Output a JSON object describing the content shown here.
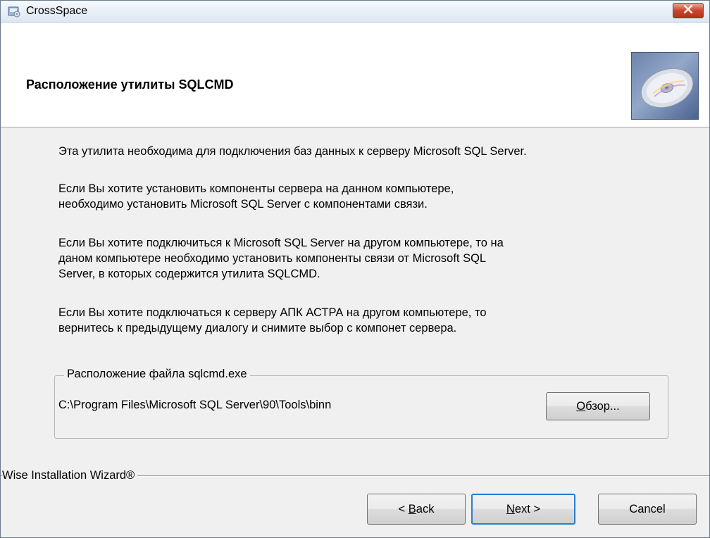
{
  "window": {
    "title": "CrossSpace"
  },
  "header": {
    "title": "Расположение утилиты SQLCMD"
  },
  "body": {
    "paragraphs": [
      [
        "Эта утилита необходима для подключения баз данных к серверу Microsoft SQL Server."
      ],
      [
        "Если Вы хотите установить компоненты сервера на данном компьютере,",
        "необходимо установить Microsoft SQL Server с компонентами связи."
      ],
      [
        "Если Вы хотите подключиться к Microsoft SQL Server на другом компьютере, то на",
        "даном компьютере необходимо установить компоненты связи от Microsoft SQL",
        "Server, в которых содержится утилита SQLCMD."
      ],
      [
        "Если Вы хотите подключаться к серверу АПК АСТРА на другом  компьютере, то",
        "вернитесь к предыдущему диалогу и снимите выбор с компонет сервера."
      ]
    ]
  },
  "file_location": {
    "legend": "Расположение файла sqlcmd.exe",
    "path": "C:\\Program Files\\Microsoft SQL Server\\90\\Tools\\binn",
    "browse_accel": "О",
    "browse_rest": "бзор..."
  },
  "footer": {
    "brand": "Wise Installation Wizard®"
  },
  "buttons": {
    "back_pre": "< ",
    "back_accel": "B",
    "back_rest": "ack",
    "next_accel": "N",
    "next_rest": "ext >",
    "cancel": "Cancel"
  },
  "colors": {
    "close_button": "#c9462c",
    "default_button_border": "#2a7dd1"
  },
  "icons": {
    "app": "installer-app-icon",
    "close": "close-icon",
    "header": "cd-disc-icon"
  }
}
